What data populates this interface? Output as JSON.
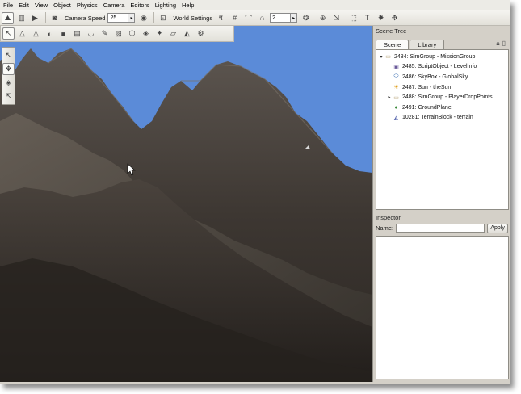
{
  "menu": [
    "File",
    "Edit",
    "View",
    "Object",
    "Physics",
    "Camera",
    "Editors",
    "Lighting",
    "Help"
  ],
  "toolbar": {
    "camera_speed_label": "Camera Speed",
    "camera_speed_value": "25",
    "world_settings_label": "World Settings",
    "snap_value": "2"
  },
  "scene_tree": {
    "title": "Scene Tree",
    "tabs": [
      "Scene",
      "Library"
    ],
    "items": [
      {
        "label": "2484: SimGroup - MissionGroup",
        "icon": "folder-icon",
        "level": 0,
        "expander": "▾"
      },
      {
        "label": "2485: ScriptObject - LevelInfo",
        "icon": "script-object-icon",
        "level": 1,
        "expander": ""
      },
      {
        "label": "2486: SkyBox - GlobalSky",
        "icon": "skybox-icon",
        "level": 1,
        "expander": ""
      },
      {
        "label": "2487: Sun - theSun",
        "icon": "sun-icon",
        "level": 1,
        "expander": ""
      },
      {
        "label": "2488: SimGroup - PlayerDropPoints",
        "icon": "folder-icon",
        "level": 1,
        "expander": "▸"
      },
      {
        "label": "2491: GroundPlane",
        "icon": "ground-plane-icon",
        "level": 1,
        "expander": ""
      },
      {
        "label": "10281: TerrainBlock - terrain",
        "icon": "terrain-icon",
        "level": 1,
        "expander": ""
      }
    ]
  },
  "inspector": {
    "title": "Inspector",
    "name_label": "Name:",
    "name_value": "",
    "apply_label": "Apply"
  },
  "colors": {
    "sky": "#5b8bd8",
    "terrain_dark": "#2f2a26",
    "terrain_light": "#6b635a",
    "panel_bg": "#d4d0c8"
  }
}
